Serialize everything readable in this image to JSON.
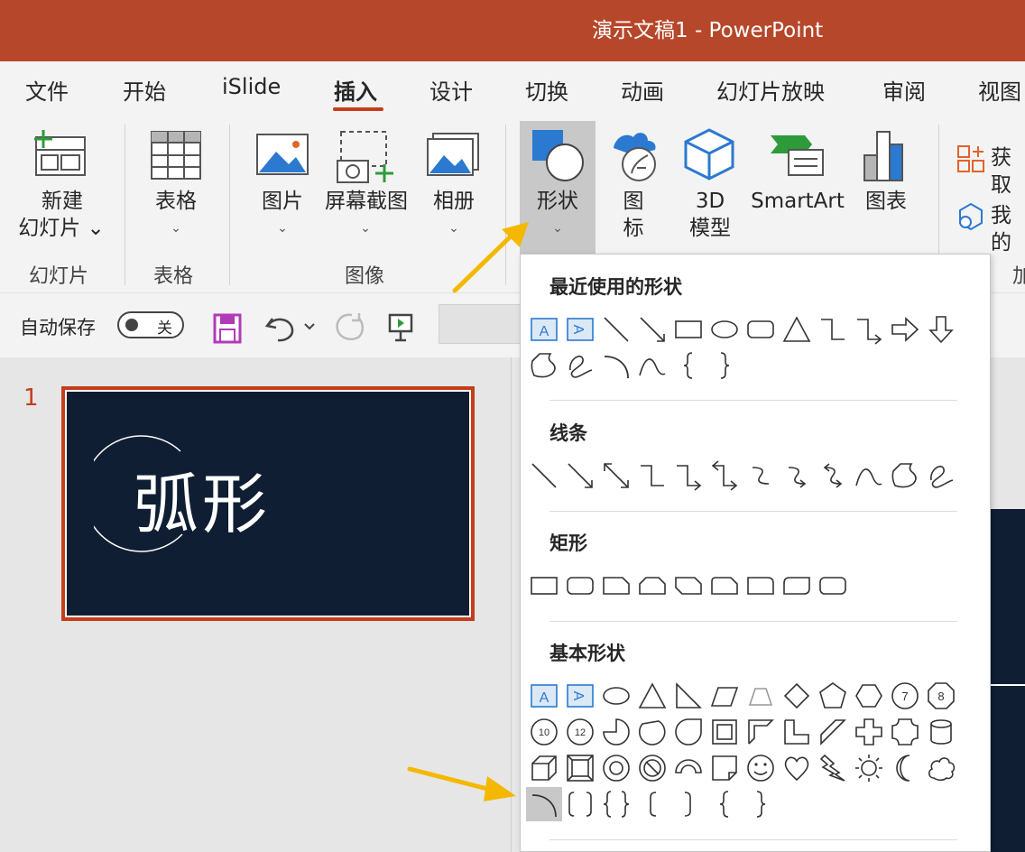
{
  "window": {
    "title": "演示文稿1  -  PowerPoint"
  },
  "tabs": [
    {
      "label": "文件"
    },
    {
      "label": "开始"
    },
    {
      "label": "iSlide"
    },
    {
      "label": "插入",
      "active": true
    },
    {
      "label": "设计"
    },
    {
      "label": "切换"
    },
    {
      "label": "动画"
    },
    {
      "label": "幻灯片放映"
    },
    {
      "label": "审阅"
    },
    {
      "label": "视图"
    }
  ],
  "ribbon": {
    "new_slide": {
      "line1": "新建",
      "line2": "幻灯片 ⌄"
    },
    "table": {
      "label": "表格"
    },
    "picture": {
      "label": "图片"
    },
    "screenshot": {
      "label": "屏幕截图"
    },
    "album": {
      "label": "相册"
    },
    "shapes": {
      "label": "形状"
    },
    "icons": {
      "line1": "图",
      "line2": "标"
    },
    "model3d": {
      "line1": "3D",
      "line2": "模型"
    },
    "smartart": {
      "label": "SmartArt"
    },
    "chart": {
      "label": "图表"
    },
    "get_addins": {
      "label": "获取"
    },
    "my_addins": {
      "label": "我的"
    },
    "caret": "⌄",
    "groups": {
      "slides": "幻灯片",
      "tables": "表格",
      "images": "图像",
      "addins": "加"
    }
  },
  "qat": {
    "autosave_label": "自动保存",
    "toggle_state": "关"
  },
  "slide_panel": {
    "slide_number": "1",
    "thumb_title": "弧形"
  },
  "shapes_menu": {
    "sections": {
      "recent": "最近使用的形状",
      "lines": "线条",
      "rectangles": "矩形",
      "basic": "基本形状"
    },
    "recent_icons": [
      "textbox-icon",
      "vertical-textbox-icon",
      "line-icon",
      "arrow-line-icon",
      "rectangle-icon",
      "oval-icon",
      "rounded-rectangle-icon",
      "triangle-icon",
      "elbow-connector-icon",
      "elbow-arrow-icon",
      "right-arrow-icon",
      "down-arrow-icon",
      "freeform-icon",
      "scribble-icon",
      "arc-icon",
      "curve-icon",
      "left-brace-icon",
      "right-brace-icon"
    ],
    "basic_selected": "arc-icon"
  },
  "colors": {
    "brand": "#b7472a",
    "accent": "#c43e1c",
    "slide_bg": "#0f1e33",
    "icon_blue": "#2b79d0",
    "highlight": "#f5b800"
  }
}
